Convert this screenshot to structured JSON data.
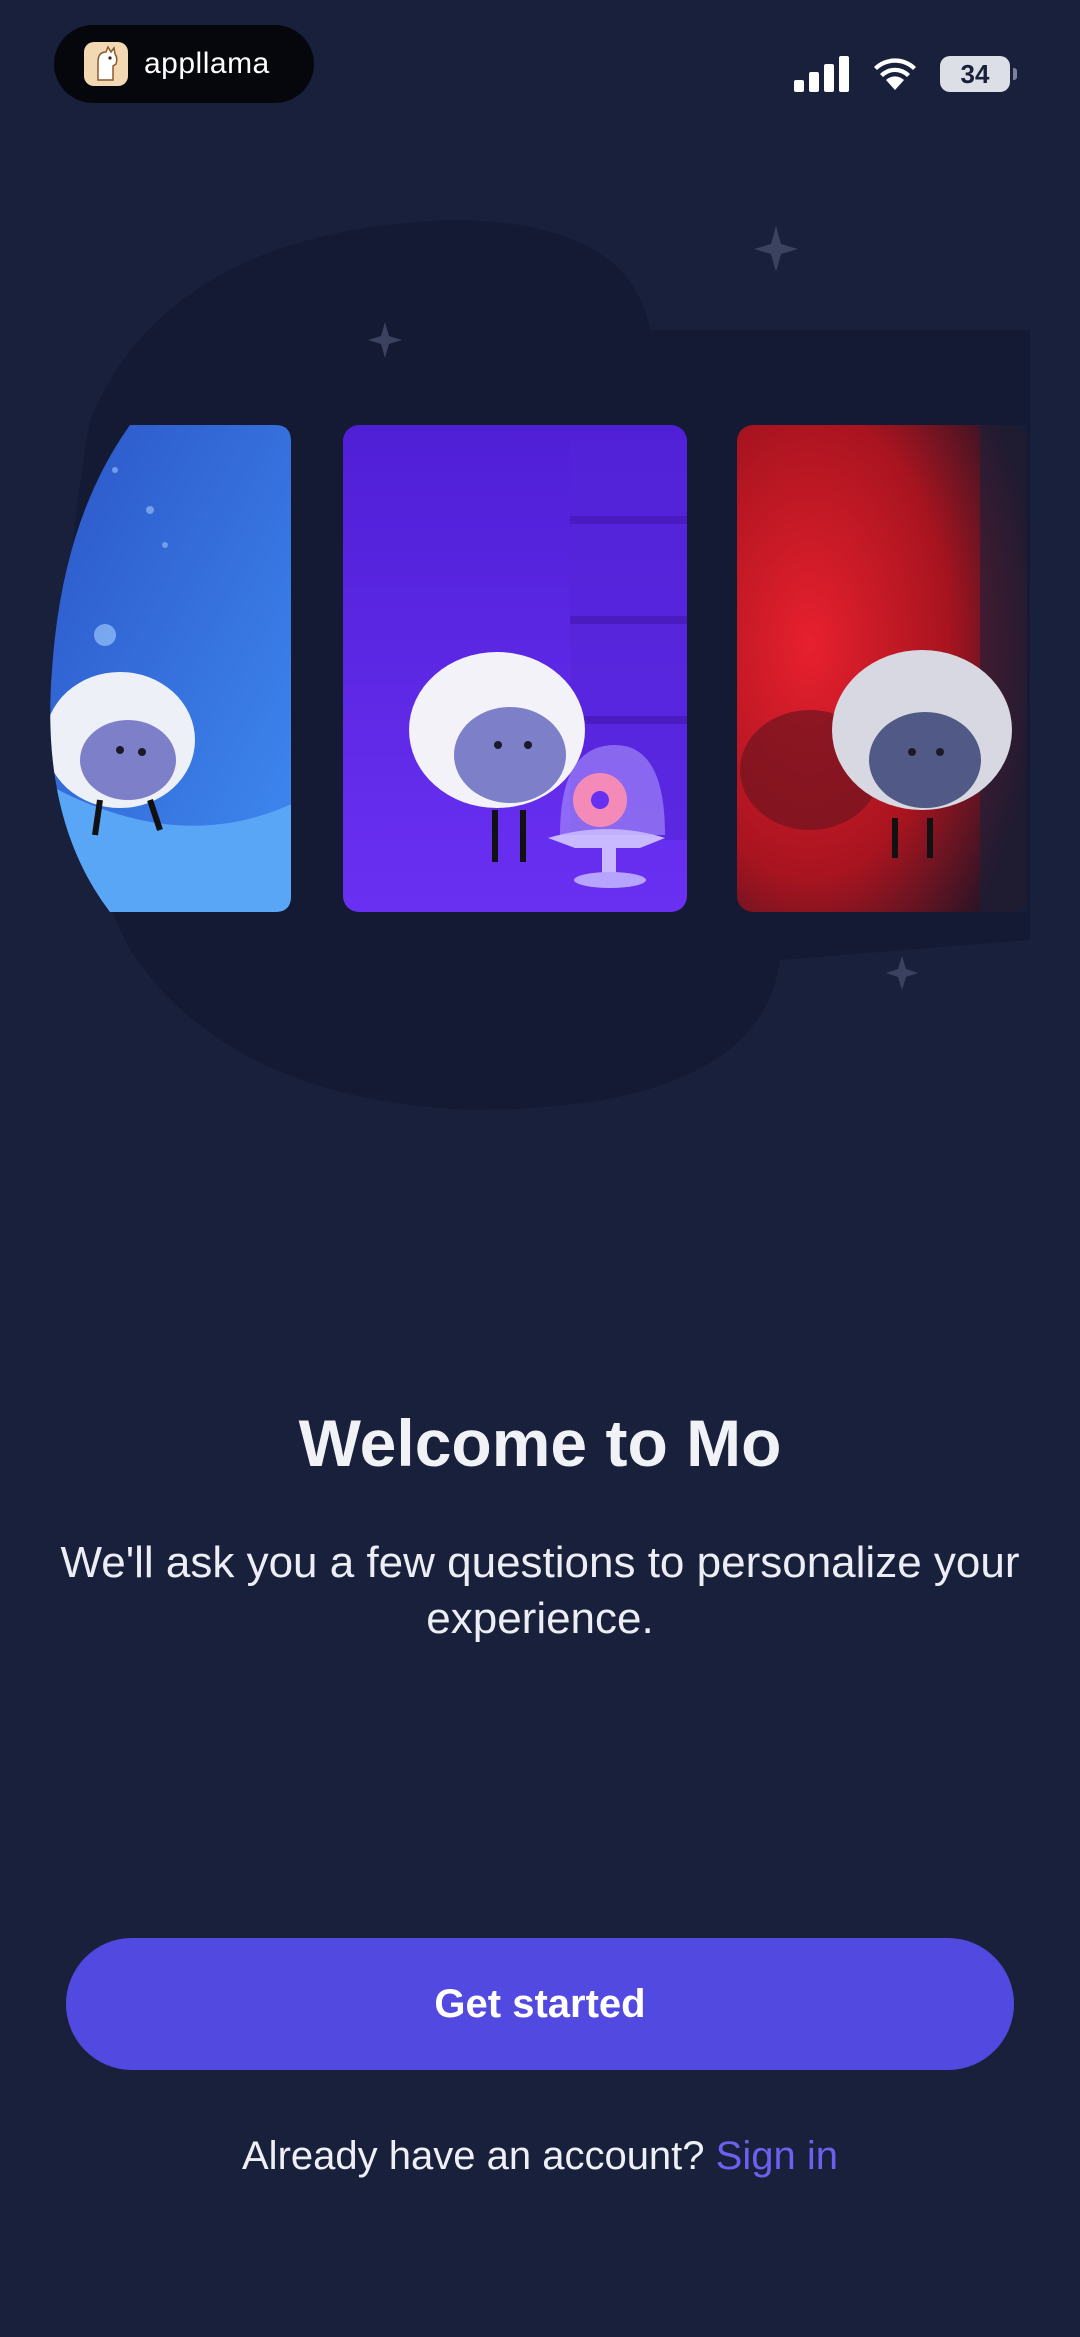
{
  "status_bar": {
    "app_badge_text": "appllama",
    "battery_level": "34",
    "signal_icon": "cellular-signal-icon",
    "wifi_icon": "wifi-icon"
  },
  "hero": {
    "cards": [
      {
        "scene": "blue-snow-sheep",
        "color": "#2f6ae0"
      },
      {
        "scene": "purple-donut-sheep",
        "color": "#6a2cf0"
      },
      {
        "scene": "red-spotlight-sheep",
        "color": "#d41a2a"
      }
    ]
  },
  "welcome": {
    "title": "Welcome to Mo",
    "subtitle": "We'll ask you a few questions to personalize your experience."
  },
  "actions": {
    "get_started_label": "Get started",
    "account_prompt": "Already have an account?",
    "sign_in_label": "Sign in"
  },
  "colors": {
    "background": "#19203b",
    "accent": "#5249e0",
    "link": "#6a61ef"
  }
}
